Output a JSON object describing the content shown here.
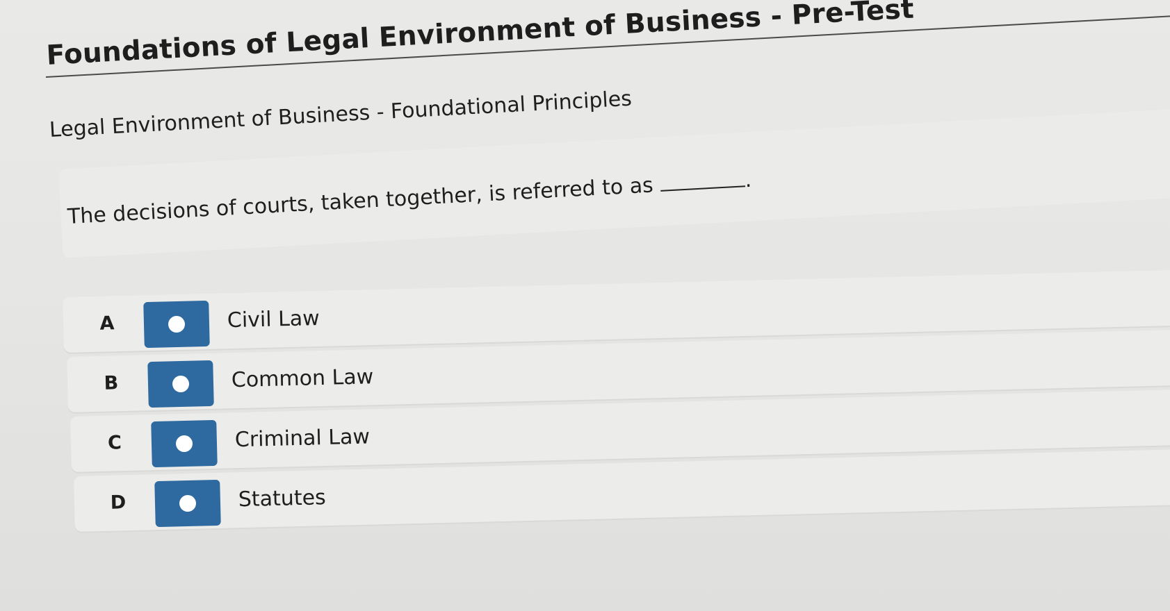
{
  "header": {
    "title": "Foundations of Legal Environment of Business - Pre-Test",
    "subtitle": "Legal Environment of Business - Foundational Principles"
  },
  "question": {
    "text": "The decisions of courts, taken together, is referred to as",
    "end_punctuation": "."
  },
  "options": [
    {
      "letter": "A",
      "text": "Civil Law"
    },
    {
      "letter": "B",
      "text": "Common Law"
    },
    {
      "letter": "C",
      "text": "Criminal Law"
    },
    {
      "letter": "D",
      "text": "Statutes"
    }
  ],
  "colors": {
    "radio_button": "#2e6aa0",
    "radio_dot": "#ffffff",
    "background": "#e6e6e4"
  },
  "icons": {
    "radio": "radio-circle-icon"
  }
}
